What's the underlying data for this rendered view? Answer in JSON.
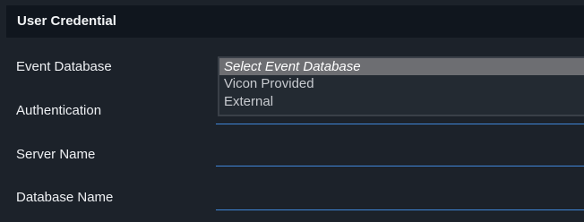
{
  "header": {
    "title": "User Credential"
  },
  "form": {
    "event_database_label": "Event Database",
    "authentication_label": "Authentication",
    "server_name_label": "Server Name",
    "database_name_label": "Database Name"
  },
  "event_database_dropdown": {
    "options": [
      "Select Event Database",
      "Vicon Provided",
      "External"
    ],
    "highlighted": "Select Event Database"
  },
  "colors": {
    "background": "#1c222a",
    "header_background": "#10161e",
    "underline_accent": "#3f86d8",
    "highlight": "#6d6e72"
  }
}
